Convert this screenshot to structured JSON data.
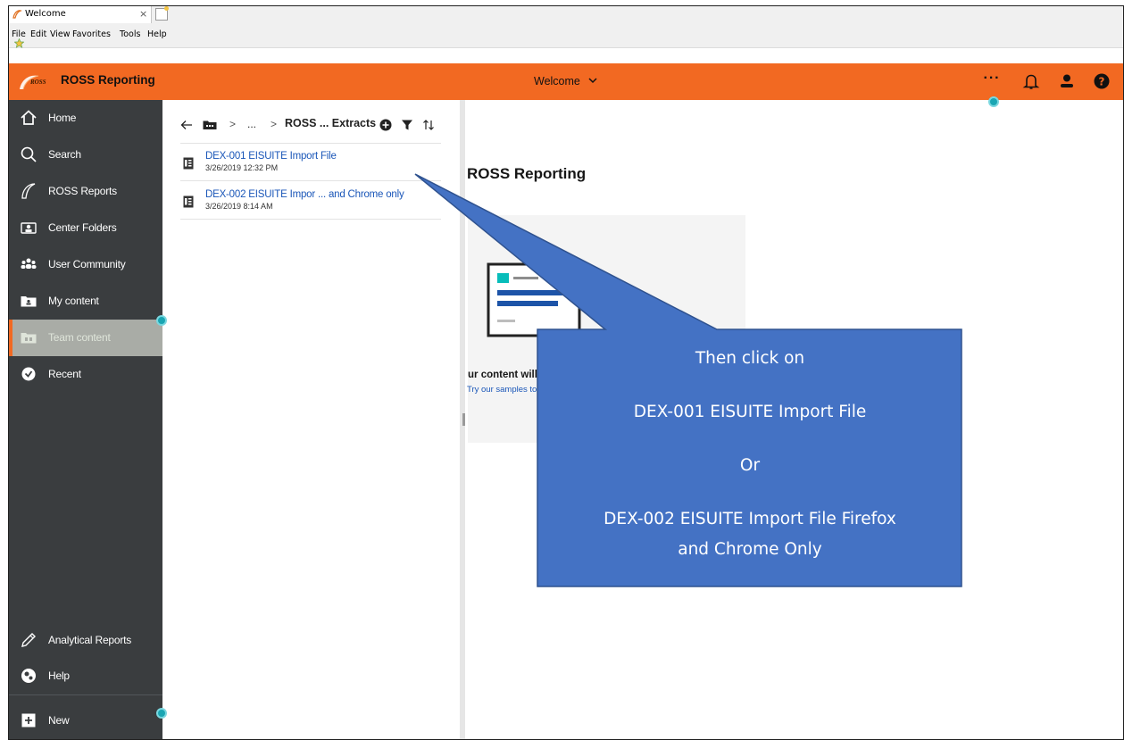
{
  "browser": {
    "tab_title": "Welcome",
    "tab_close": "×",
    "menu": [
      "File",
      "Edit",
      "View",
      "Favorites",
      "Tools",
      "Help"
    ]
  },
  "header": {
    "brand_small": "ROSS",
    "brand": "ROSS Reporting",
    "title": "Welcome",
    "more": "···",
    "accent": "#f26922"
  },
  "sidebar": {
    "items": [
      {
        "label": "Home",
        "icon": "home-icon"
      },
      {
        "label": "Search",
        "icon": "search-icon"
      },
      {
        "label": "ROSS Reports",
        "icon": "ross-logo-icon"
      },
      {
        "label": "Center Folders",
        "icon": "center-folders-icon"
      },
      {
        "label": "User Community",
        "icon": "community-icon"
      },
      {
        "label": "My content",
        "icon": "my-content-icon"
      },
      {
        "label": "Team content",
        "icon": "team-content-icon",
        "active": true
      },
      {
        "label": "Recent",
        "icon": "clock-icon"
      }
    ],
    "bottom": [
      {
        "label": "Analytical Reports",
        "icon": "pencil-icon"
      },
      {
        "label": "Help",
        "icon": "help-icon"
      },
      {
        "label": "New",
        "icon": "plus-icon"
      }
    ]
  },
  "panel": {
    "breadcrumb": {
      "ellipsis": "...",
      "sep": ">",
      "current": "ROSS ... Extracts"
    },
    "files": [
      {
        "name": "DEX-001 EISUITE Import File",
        "date": "3/26/2019 12:32 PM"
      },
      {
        "name": "DEX-002 EISUITE Impor ... and Chrome only",
        "date": "3/26/2019 8:14 AM"
      }
    ]
  },
  "main": {
    "title": "ROSS Reporting",
    "empty_text": "ur content will",
    "empty_link": "Try our samples to"
  },
  "callout": {
    "line1": "Then click on",
    "line2": "DEX-001 EISUITE Import File",
    "line3": "Or",
    "line4": "DEX-002 EISUITE Import File Firefox",
    "line5": "and Chrome Only",
    "fill": "#4472c4",
    "border": "#2f528f"
  }
}
